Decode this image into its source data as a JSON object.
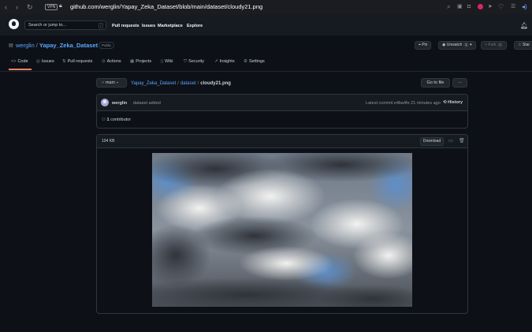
{
  "browser": {
    "vpn_label": "VPN",
    "url": "github.com/werglin/Yapay_Zeka_Dataset/blob/main/dataset/cloudy21.png"
  },
  "header": {
    "search_placeholder": "Search or jump to...",
    "search_shortcut": "/",
    "nav": [
      "Pull requests",
      "Issues",
      "Marketplace",
      "Explore"
    ]
  },
  "repo": {
    "owner": "werglin",
    "separator": "/",
    "name": "Yapay_Zeka_Dataset",
    "visibility": "Public",
    "pin_label": "Pin",
    "unwatch_label": "Unwatch",
    "unwatch_count": "1",
    "fork_label": "Fork",
    "fork_count": "0",
    "star_label": "Star"
  },
  "tabs": [
    {
      "label": "Code",
      "icon": "code-icon"
    },
    {
      "label": "Issues",
      "icon": "issue-icon"
    },
    {
      "label": "Pull requests",
      "icon": "pull-request-icon"
    },
    {
      "label": "Actions",
      "icon": "play-icon"
    },
    {
      "label": "Projects",
      "icon": "table-icon"
    },
    {
      "label": "Wiki",
      "icon": "book-icon"
    },
    {
      "label": "Security",
      "icon": "shield-icon"
    },
    {
      "label": "Insights",
      "icon": "graph-icon"
    },
    {
      "label": "Settings",
      "icon": "gear-icon"
    }
  ],
  "file": {
    "branch": "main",
    "breadcrumb": [
      "Yapay_Zeka_Dataset",
      "dataset"
    ],
    "filename": "cloudy21.png",
    "goto_label": "Go to file",
    "more_label": "···"
  },
  "commit": {
    "author": "werglin",
    "message": "dataset added",
    "meta": "Latest commit e4ba4fe 21 minutes ago",
    "history_label": "History",
    "contributors_count": "1",
    "contributors_label": "contributor"
  },
  "viewer": {
    "size": "104 KB",
    "download_label": "Download"
  },
  "colors": {
    "accent_link": "#58a6ff",
    "tab_underline": "#f78166",
    "background": "#0d1117"
  }
}
